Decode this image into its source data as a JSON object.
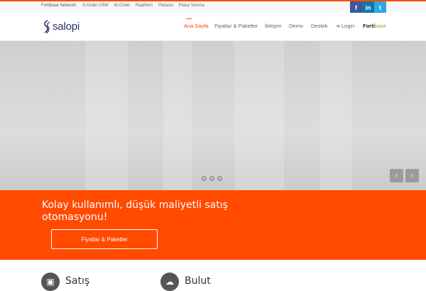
{
  "topbar": {
    "network_label": "Fortibase Network:",
    "network_links": [
      "S-Order CRM",
      "W-Order",
      "Rapiform",
      "Platasis",
      "Plaka Tanıma"
    ],
    "social": [
      {
        "icon": "facebook-icon",
        "glyph": "f",
        "color": "#3b5998"
      },
      {
        "icon": "linkedin-icon",
        "glyph": "in",
        "color": "#0e76a8"
      },
      {
        "icon": "twitter-icon",
        "glyph": "t",
        "color": "#2ca9e1"
      }
    ]
  },
  "header": {
    "logo_text": "salopi",
    "nav": {
      "home": "Ana Sayfa",
      "pricing": "Fiyatlar & Paketler",
      "contact": "İletişim",
      "demo": "Demo",
      "support": "Destek",
      "login": "Login",
      "brand_forti": "Forti",
      "brand_base": "base"
    }
  },
  "hero": {
    "slider_dots": 3,
    "prev": "‹",
    "next": "›"
  },
  "cta": {
    "headline": "Kolay kullanımlı, düşük maliyetli satış otomasyonu!",
    "button": "Fiyatlar & Paketler"
  },
  "features": [
    {
      "label": "Satış",
      "icon": "briefcase-icon"
    },
    {
      "label": "Bulut",
      "icon": "cloud-icon"
    }
  ],
  "colors": {
    "accent": "#ff4a00",
    "logo": "#29306b",
    "brand_green": "#79b51c"
  }
}
